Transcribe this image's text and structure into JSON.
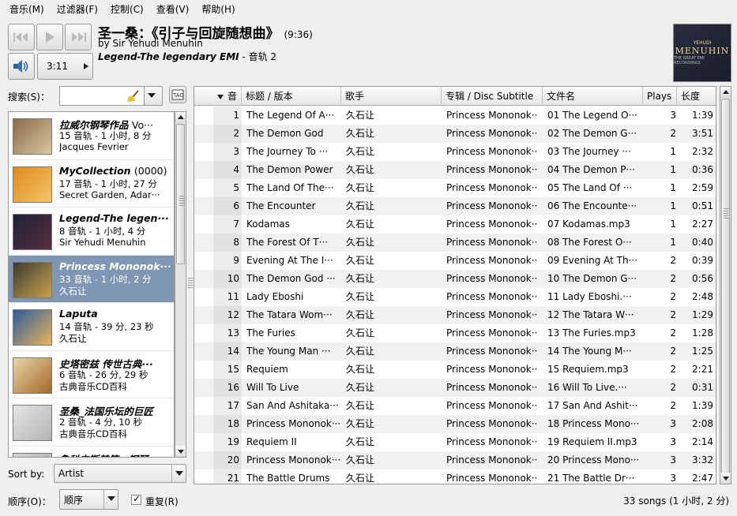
{
  "menubar": [
    "音乐(M)",
    "过滤器(F)",
    "控制(C)",
    "查看(V)",
    "帮助(H)"
  ],
  "player": {
    "time": "3:11",
    "now_playing": {
      "title": "圣一桑：《引子与回旋随想曲》",
      "duration": "(9:36)",
      "by": "by Sir Yehudi Menuhin",
      "album": "Legend-The legendary EMI",
      "track": " - 音轨 2"
    },
    "cover": {
      "line1": "YEHUDI",
      "line2": "MENUHIN",
      "line3": "THE GREAT EMI RECORDINGS"
    }
  },
  "search": {
    "label": "搜索(S)：",
    "value": ""
  },
  "albums": [
    {
      "title": "拉威尔钢琴作品",
      "count": "Vo···",
      "info": "15 音轨 - 1 小时, 8 分",
      "artist": "Jacques Fevrier",
      "colors": [
        "#8a6a4a",
        "#d9c7a0"
      ]
    },
    {
      "title": "MyCollection",
      "count": "(0000)",
      "info": "17 音轨 - 1 小时, 27 分",
      "artist": "Secret Garden, Adar···",
      "colors": [
        "#e08a1a",
        "#f3c46a"
      ]
    },
    {
      "title": "Legend-The legen···",
      "count": "",
      "info": "8 音轨 - 1 小时, 4 分",
      "artist": "Sir Yehudi Menuhin",
      "colors": [
        "#1e2236",
        "#5a2e3e"
      ]
    },
    {
      "title": "Princess Mononok···",
      "count": "",
      "info": "33 音轨 - 1 小时, 2 分",
      "artist": "久石让",
      "colors": [
        "#3c3a30",
        "#c9a24a"
      ]
    },
    {
      "title": "Laputa",
      "count": "",
      "info": "14 音轨 - 39 分, 23 秒",
      "artist": "久石让",
      "colors": [
        "#2c5c9a",
        "#e9b45a"
      ]
    },
    {
      "title": "史塔密兹 传世古典···",
      "count": "",
      "info": "6 音轨 - 26 分, 29 秒",
      "artist": "古典音乐CD百科",
      "colors": [
        "#e9d6a6",
        "#a4682a"
      ]
    },
    {
      "title": "圣桑_法国乐坛的巨匠",
      "count": "",
      "info": "2 音轨 - 4 分, 10 秒",
      "artist": "古典音乐CD百科",
      "colors": [
        "#e4e4e4",
        "#b4b4b4"
      ]
    },
    {
      "title": "鲁科夫斯基第一钢琴···",
      "count": "",
      "info": "",
      "artist": "",
      "colors": [
        "#d4d4d4",
        "#a0a0a0"
      ]
    }
  ],
  "sort": {
    "label": "Sort by:",
    "value": "Artist"
  },
  "order": {
    "label": "顺序(O)：",
    "value": "顺序"
  },
  "repeat": {
    "label": "重复(R)"
  },
  "table": {
    "headers": [
      "音",
      "标题 / 版本",
      "歌手",
      "专辑 / Disc Subtitle",
      "文件名",
      "Plays",
      "长度"
    ],
    "rows": [
      [
        "1",
        "The Legend Of A···",
        "久石让",
        "Princess Mononok···",
        "01 The Legend O···",
        "3",
        "1:39"
      ],
      [
        "2",
        "The Demon God",
        "久石让",
        "Princess Mononok···",
        "02 The Demon G···",
        "2",
        "3:51"
      ],
      [
        "3",
        "The Journey To ···",
        "久石让",
        "Princess Mononok···",
        "03 The Journey ···",
        "1",
        "2:32"
      ],
      [
        "4",
        "The Demon Power",
        "久石让",
        "Princess Mononok···",
        "04 The Demon P···",
        "1",
        "0:36"
      ],
      [
        "5",
        "The Land Of The···",
        "久石让",
        "Princess Mononok···",
        "05 The Land Of ···",
        "1",
        "2:59"
      ],
      [
        "6",
        "The Encounter",
        "久石让",
        "Princess Mononok···",
        "06 The Encounte···",
        "1",
        "0:51"
      ],
      [
        "7",
        "Kodamas",
        "久石让",
        "Princess Mononok···",
        "07 Kodamas.mp3",
        "1",
        "2:27"
      ],
      [
        "8",
        "The Forest Of T···",
        "久石让",
        "Princess Mononok···",
        "08 The Forest O···",
        "1",
        "0:40"
      ],
      [
        "9",
        "Evening At The I···",
        "久石让",
        "Princess Mononok···",
        "09 Evening At Th···",
        "2",
        "0:39"
      ],
      [
        "10",
        "The Demon God ···",
        "久石让",
        "Princess Mononok···",
        "10 The Demon G···",
        "2",
        "0:56"
      ],
      [
        "11",
        "Lady Eboshi",
        "久石让",
        "Princess Mononok···",
        "11 Lady Eboshi.···",
        "2",
        "2:48"
      ],
      [
        "12",
        "The Tatara Wom···",
        "久石让",
        "Princess Mononok···",
        "12 The Tatara W···",
        "2",
        "1:29"
      ],
      [
        "13",
        "The Furies",
        "久石让",
        "Princess Mononok···",
        "13 The Furies.mp3",
        "2",
        "1:28"
      ],
      [
        "14",
        "The Young Man ···",
        "久石让",
        "Princess Mononok···",
        "14 The Young M···",
        "2",
        "1:25"
      ],
      [
        "15",
        "Requiem",
        "久石让",
        "Princess Mononok···",
        "15 Requiem.mp3",
        "2",
        "2:21"
      ],
      [
        "16",
        "Will To Live",
        "久石让",
        "Princess Mononok···",
        "16 Will To Live.···",
        "2",
        "0:31"
      ],
      [
        "17",
        "San And Ashitaka···",
        "久石让",
        "Princess Mononok···",
        "17 San And Ashit···",
        "2",
        "1:39"
      ],
      [
        "18",
        "Princess Mononok···",
        "久石让",
        "Princess Mononok···",
        "18 Princess Mono···",
        "3",
        "2:08"
      ],
      [
        "19",
        "Requiem II",
        "久石让",
        "Princess Mononok···",
        "19 Requiem II.mp3",
        "3",
        "2:14"
      ],
      [
        "20",
        "Princess Mononok···",
        "久石让",
        "Princess Mononok···",
        "20 Princess Mono···",
        "3",
        "3:32"
      ],
      [
        "21",
        "The Battle Drums",
        "久石让",
        "Princess Mononok···",
        "21 The Battle Dr···",
        "3",
        "2:47"
      ]
    ]
  },
  "status": "33 songs (1 小时, 2 分)"
}
